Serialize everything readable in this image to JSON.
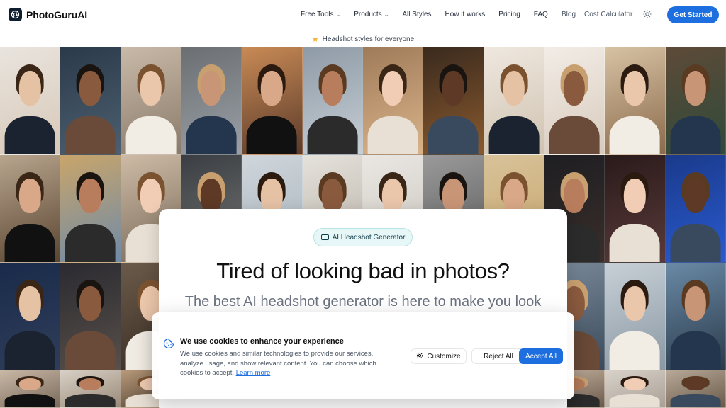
{
  "brand": {
    "name": "PhotoGuruAI"
  },
  "nav": {
    "items": [
      {
        "label": "Free Tools",
        "dropdown": true
      },
      {
        "label": "Products",
        "dropdown": true
      },
      {
        "label": "All Styles",
        "dropdown": false
      },
      {
        "label": "How it works",
        "dropdown": false
      },
      {
        "label": "Pricing",
        "dropdown": false
      },
      {
        "label": "FAQ",
        "dropdown": false
      }
    ],
    "secondary": [
      "Blog",
      "Cost Calculator"
    ],
    "theme_icon": "sun-icon",
    "cta": "Get Started"
  },
  "banner": {
    "text": "Headshot styles for everyone",
    "icon": "star-icon",
    "icon_color": "#f2b233"
  },
  "hero": {
    "badge": "AI Headshot Generator",
    "title": "Tired of looking bad in photos?",
    "subtitle": "The best AI headshot generator is here to make you look"
  },
  "cookie": {
    "title": "We use cookies to enhance your experience",
    "body": "We use cookies and similar technologies to provide our services, analyze usage, and show relevant content. You can choose which cookies to accept.",
    "link": "Learn more",
    "customize": "Customize",
    "reject": "Reject All",
    "accept": "Accept All"
  },
  "colors": {
    "accent": "#1d6fe0",
    "badge_bg": "#e7f6f6"
  }
}
